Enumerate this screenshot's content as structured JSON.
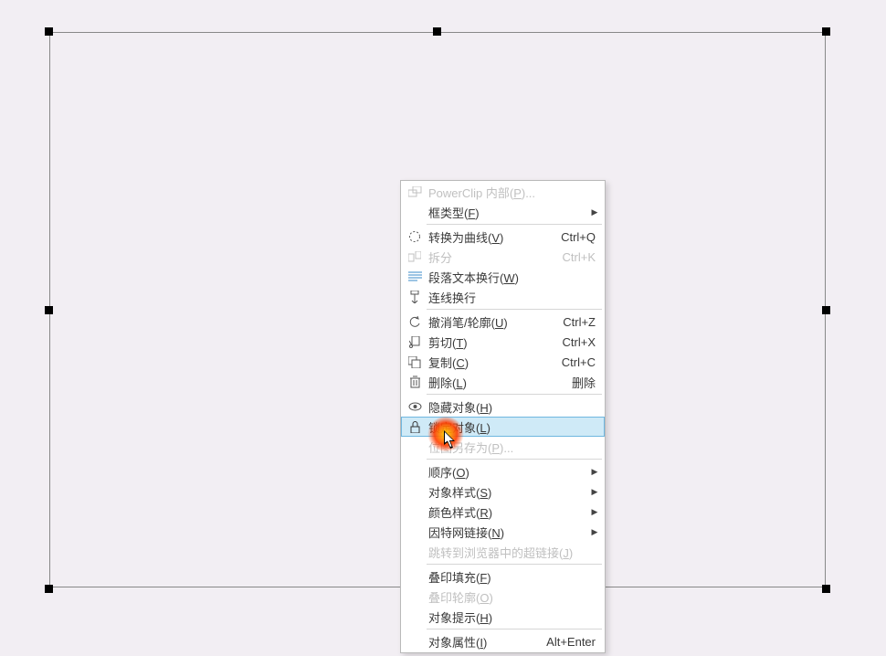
{
  "menu": {
    "powerclip": {
      "label": "PowerClip 内部(",
      "accel": "P",
      "suffix": ")..."
    },
    "frameType": {
      "label": "框类型(",
      "accel": "F",
      "suffix": ")"
    },
    "toCurves": {
      "label": "转换为曲线(",
      "accel": "V",
      "suffix": ")",
      "shortcut": "Ctrl+Q"
    },
    "split": {
      "label": "拆分",
      "shortcut": "Ctrl+K"
    },
    "wrapText": {
      "label": "段落文本换行(",
      "accel": "W",
      "suffix": ")"
    },
    "connector": {
      "label": "连线换行"
    },
    "undoOutline": {
      "label": "撤消笔/轮廓(",
      "accel": "U",
      "suffix": ")",
      "shortcut": "Ctrl+Z"
    },
    "cut": {
      "label": "剪切(",
      "accel": "T",
      "suffix": ")",
      "shortcut": "Ctrl+X"
    },
    "copy": {
      "label": "复制(",
      "accel": "C",
      "suffix": ")",
      "shortcut": "Ctrl+C"
    },
    "delete": {
      "label": "删除(",
      "accel": "L",
      "suffix": ")",
      "shortcut": "删除"
    },
    "hide": {
      "label": "隐藏对象(",
      "accel": "H",
      "suffix": ")"
    },
    "lock": {
      "label": "锁定对象(",
      "accel": "L",
      "suffix": ")"
    },
    "saveBitmap": {
      "label": "位图另存为(",
      "accel": "P",
      "suffix": ")..."
    },
    "order": {
      "label": "顺序(",
      "accel": "O",
      "suffix": ")"
    },
    "objStyle": {
      "label": "对象样式(",
      "accel": "S",
      "suffix": ")"
    },
    "colorStyle": {
      "label": "颜色样式(",
      "accel": "R",
      "suffix": ")"
    },
    "hyperlink": {
      "label": "因特网链接(",
      "accel": "N",
      "suffix": ")"
    },
    "jumpLink": {
      "label": "跳转到浏览器中的超链接(",
      "accel": "J",
      "suffix": ")"
    },
    "overprintF": {
      "label": "叠印填充(",
      "accel": "F",
      "suffix": ")"
    },
    "overprintO": {
      "label": "叠印轮廓(",
      "accel": "O",
      "suffix": ")"
    },
    "hint": {
      "label": "对象提示(",
      "accel": "H",
      "suffix": ")"
    },
    "props": {
      "label": "对象属性(",
      "accel": "I",
      "suffix": ")",
      "shortcut": "Alt+Enter"
    }
  }
}
